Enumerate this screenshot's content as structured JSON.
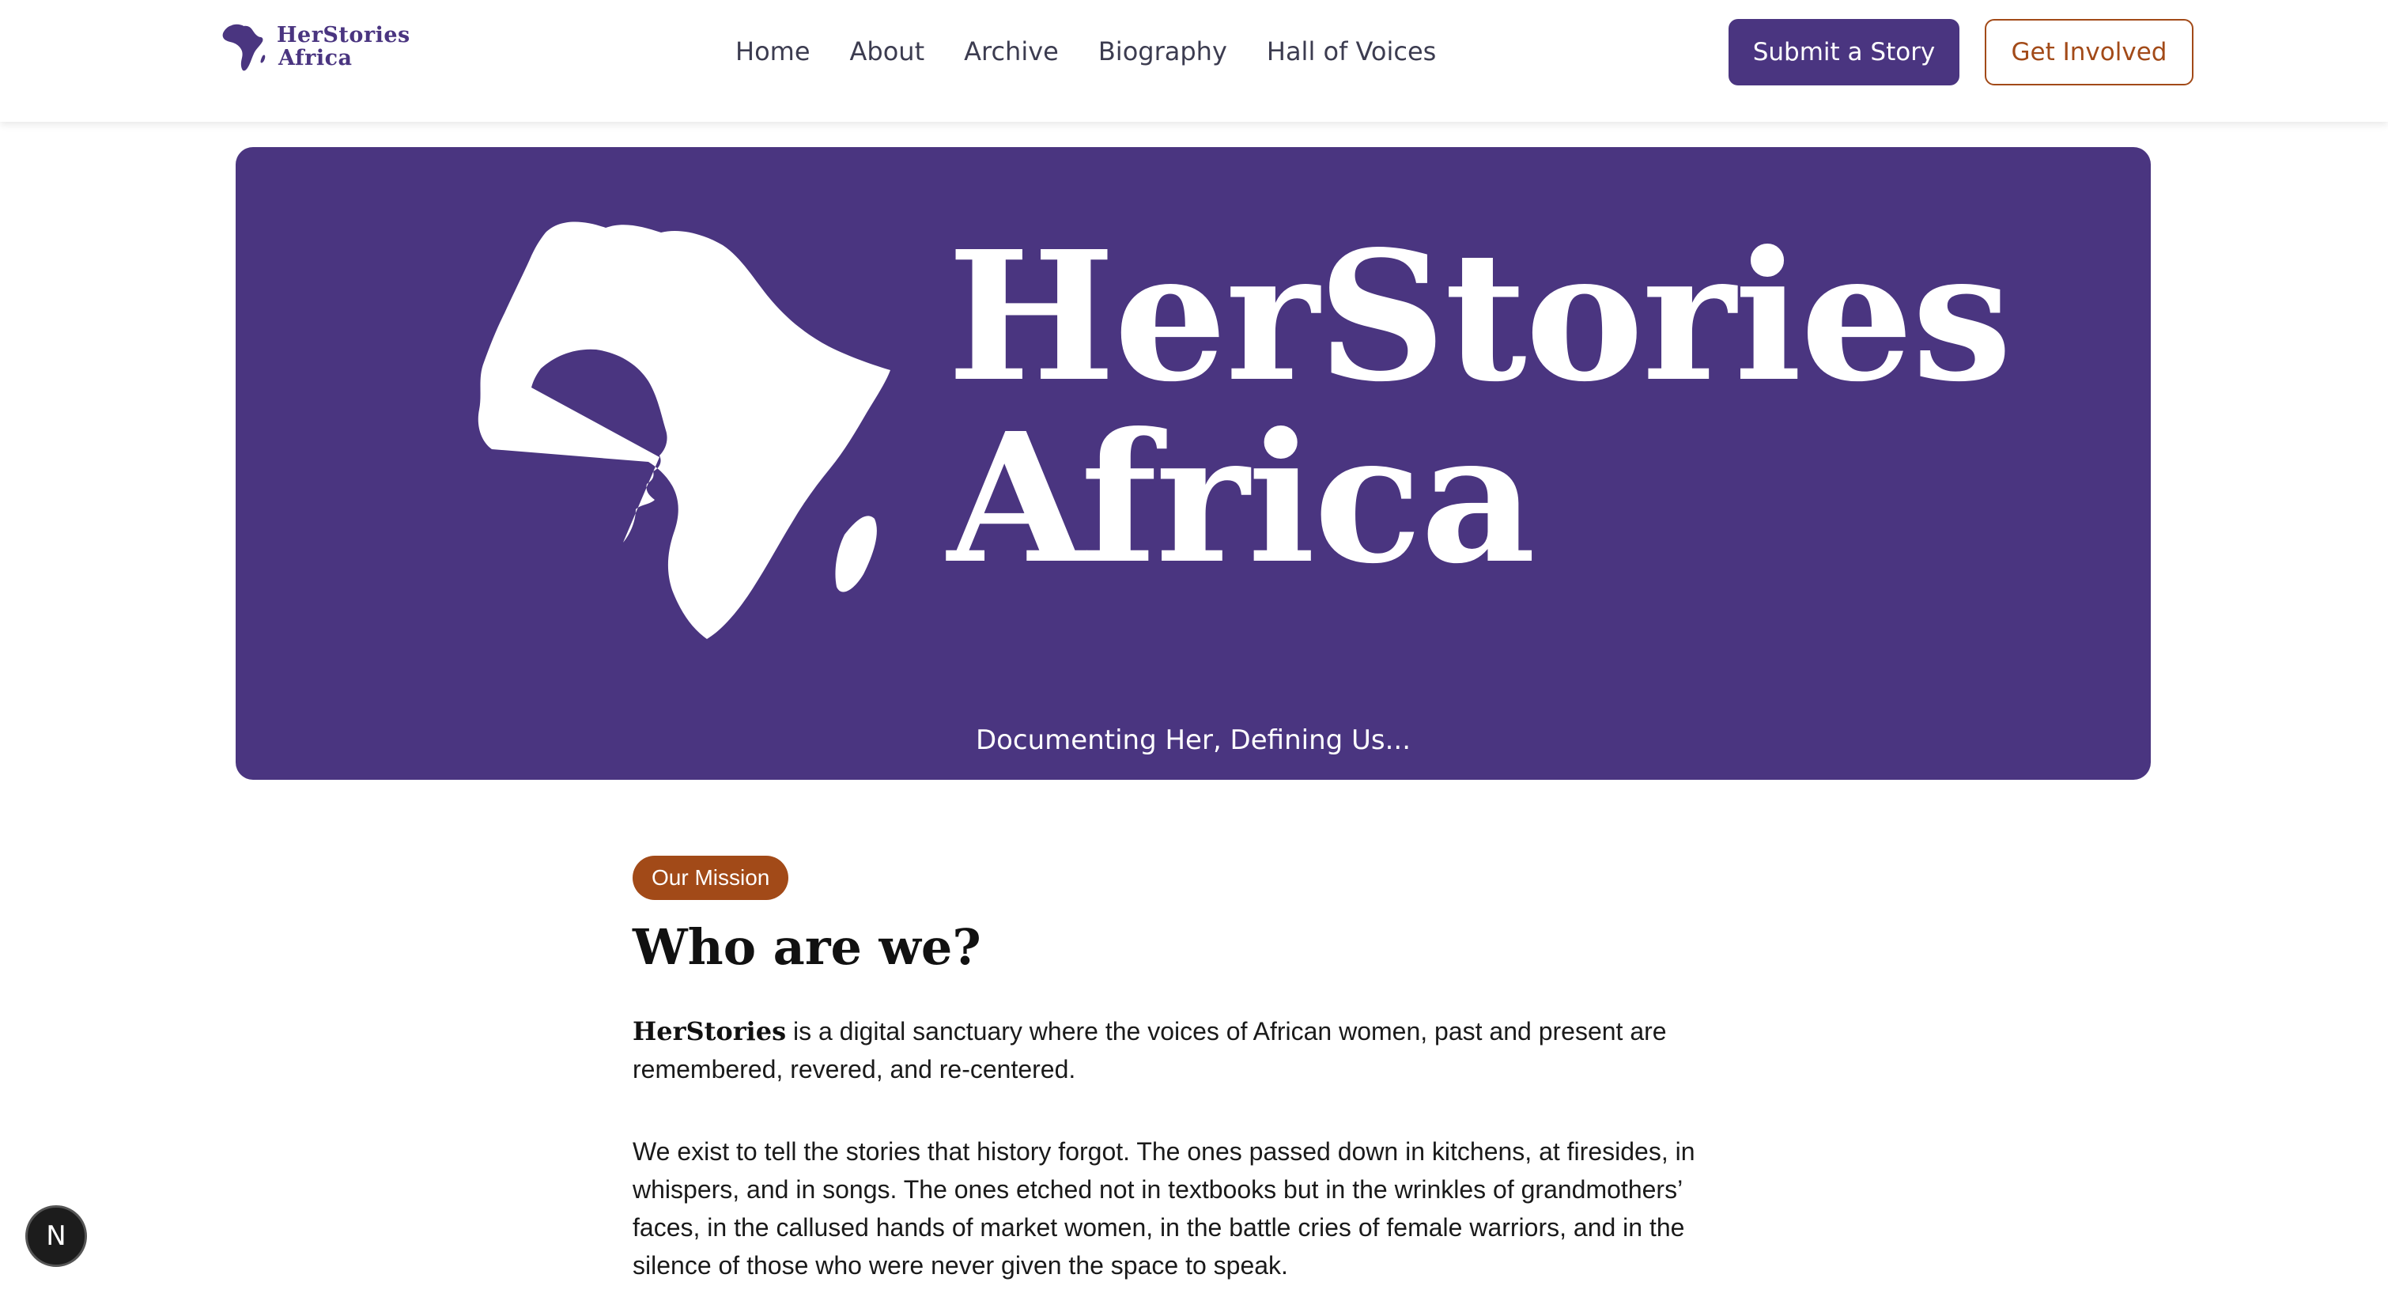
{
  "brand": {
    "logo_line1": "HerStories",
    "logo_line2": "Africa",
    "primary_color": "#4a3580",
    "accent_color": "#a24a18"
  },
  "nav": {
    "items": [
      {
        "label": "Home"
      },
      {
        "label": "About"
      },
      {
        "label": "Archive"
      },
      {
        "label": "Biography"
      },
      {
        "label": "Hall of Voices"
      }
    ]
  },
  "header_actions": {
    "submit_label": "Submit a Story",
    "involved_label": "Get Involved"
  },
  "hero": {
    "title_line1": "HerStories",
    "title_line2": "Africa",
    "tagline": "Documenting Her, Defining Us...",
    "icon": "africa-profile-icon"
  },
  "mission": {
    "badge": "Our Mission",
    "heading": "Who are we?",
    "para1_brand": "HerStories",
    "para1_text": " is a digital sanctuary where the voices of African women, past and present are remembered, revered, and re-centered.",
    "para2_text": "We exist to tell the stories that history forgot. The ones passed down in kitchens, at firesides, in whispers, and in songs. The ones etched not in textbooks but in the wrinkles of grandmothers’ faces, in the callused hands of market women, in the battle cries of female warriors, and in the silence of those who were never given the space to speak."
  },
  "floating_button": {
    "label": "N"
  }
}
